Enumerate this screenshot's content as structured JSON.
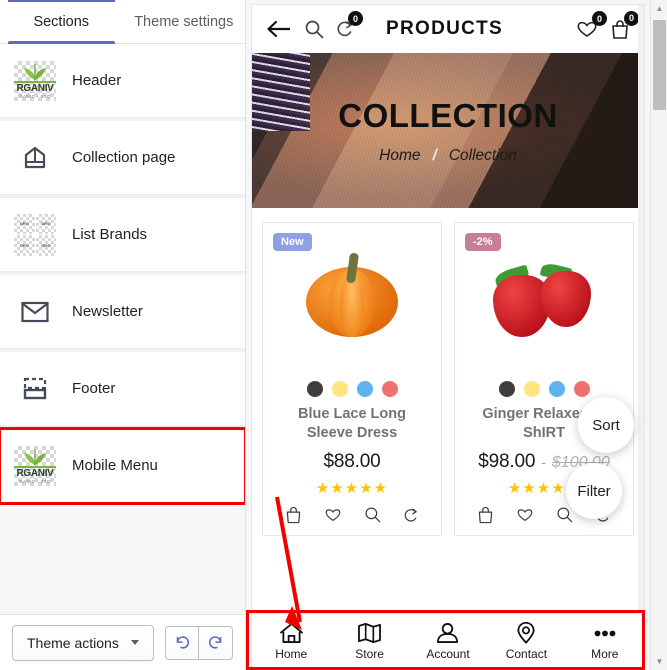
{
  "sidebar": {
    "tabs": [
      {
        "label": "Sections",
        "active": true
      },
      {
        "label": "Theme settings",
        "active": false
      }
    ],
    "items": [
      {
        "label": "Header",
        "icon": "store-logo-icon",
        "highlighted": false
      },
      {
        "label": "Collection page",
        "icon": "collection-tag-icon",
        "highlighted": false
      },
      {
        "label": "List Brands",
        "icon": "brand-grid-icon",
        "highlighted": false
      },
      {
        "label": "Newsletter",
        "icon": "envelope-icon",
        "highlighted": false
      },
      {
        "label": "Footer",
        "icon": "footer-layout-icon",
        "highlighted": false
      },
      {
        "label": "Mobile Menu",
        "icon": "store-logo-icon",
        "highlighted": true
      }
    ],
    "logo": {
      "word": "RGANIV",
      "sub": "GANIC - STO"
    },
    "footer": {
      "theme_actions_label": "Theme actions",
      "undo_label": "undo-icon",
      "redo_label": "redo-icon"
    }
  },
  "preview": {
    "header": {
      "back_icon": "arrow-left-icon",
      "search_icon": "search-icon",
      "compare_icon": "compare-icon",
      "compare_count": "0",
      "title": "PRODUCTS",
      "wishlist_icon": "heart-icon",
      "wishlist_count": "0",
      "cart_icon": "shopping-bag-icon",
      "cart_count": "0"
    },
    "banner": {
      "title": "COLLECTION",
      "breadcrumb_home": "Home",
      "breadcrumb_separator": "/",
      "breadcrumb_current": "Collection"
    },
    "products": [
      {
        "badge": "New",
        "badge_color": "#8e9fe3",
        "image": "pumpkin-image",
        "swatches": [
          "#3d3d3d",
          "#ffe57f",
          "#5bb4f0",
          "#f07070"
        ],
        "title": "Blue Lace Long Sleeve Dress",
        "price": "$88.00",
        "price_separator": "",
        "price_old": "",
        "rating": "★★★★★",
        "actions": [
          "add-to-cart-icon",
          "wishlist-icon",
          "quick-view-icon",
          "compare-icon"
        ]
      },
      {
        "badge": "-2%",
        "badge_color": "#c77f95",
        "image": "strawberries-image",
        "swatches": [
          "#3d3d3d",
          "#ffe57f",
          "#5bb4f0",
          "#f07070"
        ],
        "title": "Ginger Relaxed T-ShIRT",
        "price": "$98.00",
        "price_separator": "-",
        "price_old": "$100.00",
        "rating": "★★★★★",
        "actions": [
          "add-to-cart-icon",
          "wishlist-icon",
          "quick-view-icon",
          "compare-icon"
        ]
      }
    ],
    "floating": {
      "sort_label": "Sort",
      "filter_label": "Filter"
    },
    "mobile_menu": [
      {
        "label": "Home",
        "icon": "house-icon"
      },
      {
        "label": "Store",
        "icon": "map-icon"
      },
      {
        "label": "Account",
        "icon": "person-icon"
      },
      {
        "label": "Contact",
        "icon": "location-pin-icon"
      },
      {
        "label": "More",
        "icon": "ellipsis-icon"
      }
    ]
  },
  "annotation": {
    "highlight_color": "#f10000",
    "arrow_from": "Mobile Menu",
    "arrow_to": "mobile-menu-bar"
  }
}
